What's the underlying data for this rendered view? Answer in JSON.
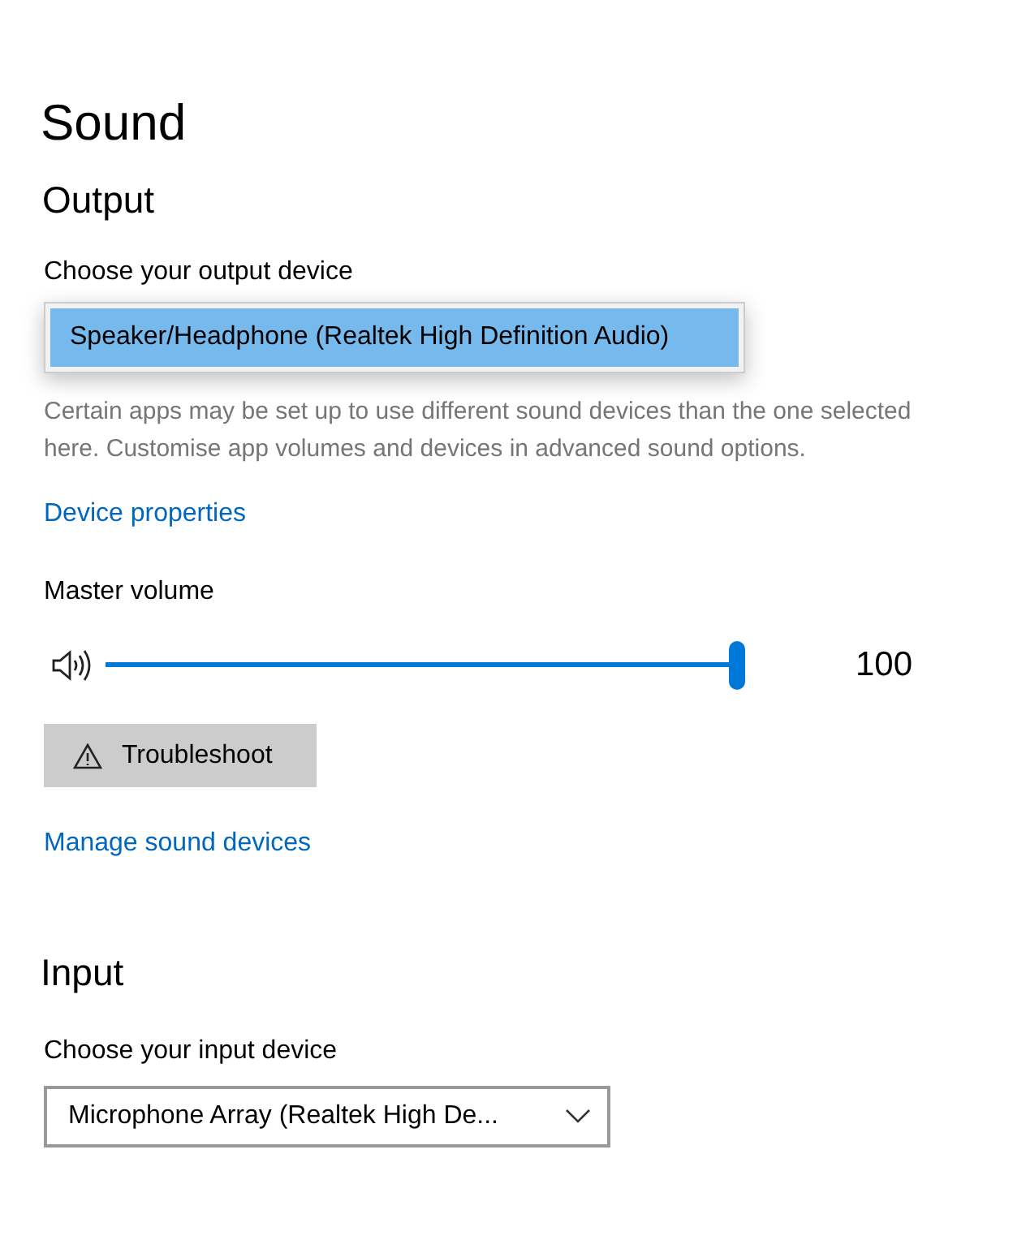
{
  "page_title": "Sound",
  "output": {
    "heading": "Output",
    "device_label": "Choose your output device",
    "dropdown": {
      "expanded": true,
      "options": [
        {
          "label": "Speaker/Headphone (Realtek High Definition Audio)",
          "selected": true
        }
      ]
    },
    "description": "Certain apps may be set up to use different sound devices than the one selected here. Customise app volumes and devices in advanced sound options.",
    "properties_link": "Device properties",
    "volume": {
      "label": "Master volume",
      "level": 1,
      "reading": "100"
    },
    "troubleshoot_button": "Troubleshoot",
    "manage_link": "Manage sound devices"
  },
  "input": {
    "heading": "Input",
    "device_label": "Choose your input device",
    "dropdown": {
      "expanded": false,
      "value": "Microphone Array (Realtek High De..."
    }
  }
}
